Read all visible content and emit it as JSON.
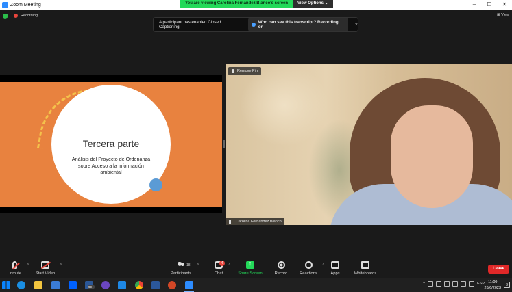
{
  "window": {
    "title": "Zoom Meeting"
  },
  "banner": {
    "viewing_text": "You are viewing Carolina Fernandez Blanco's screen",
    "view_options": "View Options"
  },
  "topbar": {
    "recording_label": "Recording",
    "view_label": "View"
  },
  "cc_notice": {
    "message": "A participant has enabled Closed Captioning",
    "action": "Who can see this transcript? Recording on",
    "close": "×"
  },
  "slide": {
    "title": "Tercera parte",
    "subtitle_lines": [
      "Análisis del Proyecto de Ordenanza",
      "sobre Acceso a la información",
      "ambiental"
    ]
  },
  "video": {
    "pin_label": "Remove Pin",
    "participant_name": "Carolina Fernandez Blanco"
  },
  "toolbar": {
    "unmute": "Unmute",
    "start_video": "Start Video",
    "participants": "Participants",
    "participants_count": "18",
    "chat": "Chat",
    "chat_badge": "4",
    "share_screen": "Share Screen",
    "record": "Record",
    "reactions": "Reactions",
    "apps": "Apps",
    "whiteboards": "Whiteboards",
    "leave": "Leave"
  },
  "taskbar": {
    "badge_count": "99+",
    "language": "ESP",
    "time": "11:09",
    "date": "26/6/2023",
    "notification_count": "3"
  },
  "colors": {
    "share_green": "#23d959",
    "leave_red": "#e02828",
    "slide_orange": "#e8823f"
  }
}
